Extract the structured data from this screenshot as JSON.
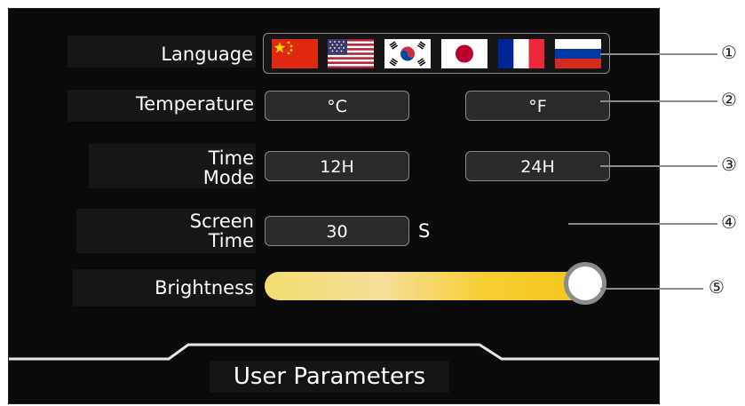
{
  "screen": {
    "title": "User Parameters",
    "language": {
      "label": "Language",
      "flags": [
        "china-flag",
        "usa-flag",
        "korea-flag",
        "japan-flag",
        "france-flag",
        "russia-flag"
      ]
    },
    "temperature": {
      "label": "Temperature",
      "options": [
        "°C",
        "°F"
      ]
    },
    "time_mode": {
      "label_line1": "Time",
      "label_line2": "Mode",
      "options": [
        "12H",
        "24H"
      ]
    },
    "screen_time": {
      "label_line1": "Screen",
      "label_line2": "Time",
      "value": "30",
      "unit": "S"
    },
    "brightness": {
      "label": "Brightness",
      "level_fraction": 1.0
    }
  },
  "callouts": [
    "①",
    "②",
    "③",
    "④",
    "⑤"
  ],
  "colors": {
    "background": "#0b0b0b",
    "slider_start": "#f2dd6f",
    "slider_end": "#f5c418",
    "button_fill": "#2b2b2b"
  }
}
